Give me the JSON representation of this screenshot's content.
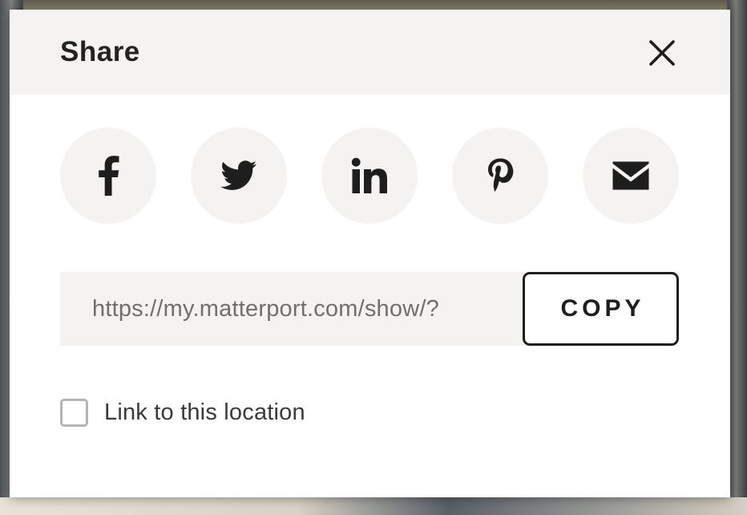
{
  "dialog": {
    "title": "Share"
  },
  "social_buttons": [
    {
      "name": "facebook",
      "icon": "facebook-icon"
    },
    {
      "name": "twitter",
      "icon": "twitter-icon"
    },
    {
      "name": "linkedin",
      "icon": "linkedin-icon"
    },
    {
      "name": "pinterest",
      "icon": "pinterest-icon"
    },
    {
      "name": "email",
      "icon": "email-icon"
    }
  ],
  "share_link": {
    "url": "https://my.matterport.com/show/?",
    "copy_label": "COPY"
  },
  "options": {
    "link_location_label": "Link to this location",
    "link_location_checked": false
  },
  "colors": {
    "header_bg": "#f4f3f1",
    "icon": "#1e1e1e",
    "button_bg": "#f4f3f1"
  }
}
